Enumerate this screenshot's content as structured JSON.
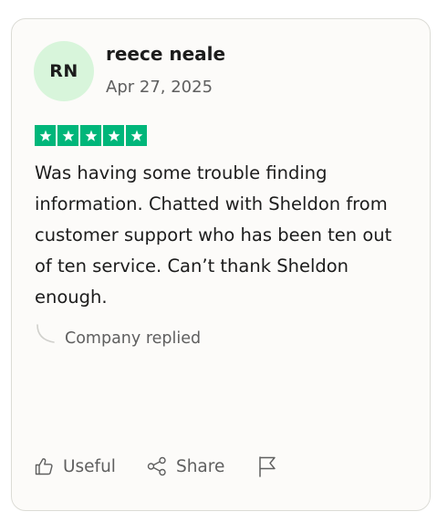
{
  "review": {
    "avatar_initials": "RN",
    "reviewer_name": "reece neale",
    "date": "Apr 27, 2025",
    "rating": 5,
    "rating_max": 5,
    "text": "Was having some trouble finding information. Chatted with Sheldon from customer support who has been ten out of ten service. Can’t thank Sheldon enough.",
    "reply_label": "Company replied"
  },
  "actions": {
    "useful_label": "Useful",
    "share_label": "Share",
    "useful_icon": "thumbs-up-icon",
    "share_icon": "share-icon",
    "report_icon": "flag-icon"
  },
  "colors": {
    "star_green": "#00b67a",
    "avatar_bg": "#d8f5db",
    "card_bg": "#fcfbf9",
    "muted_text": "#5f5f5f"
  }
}
